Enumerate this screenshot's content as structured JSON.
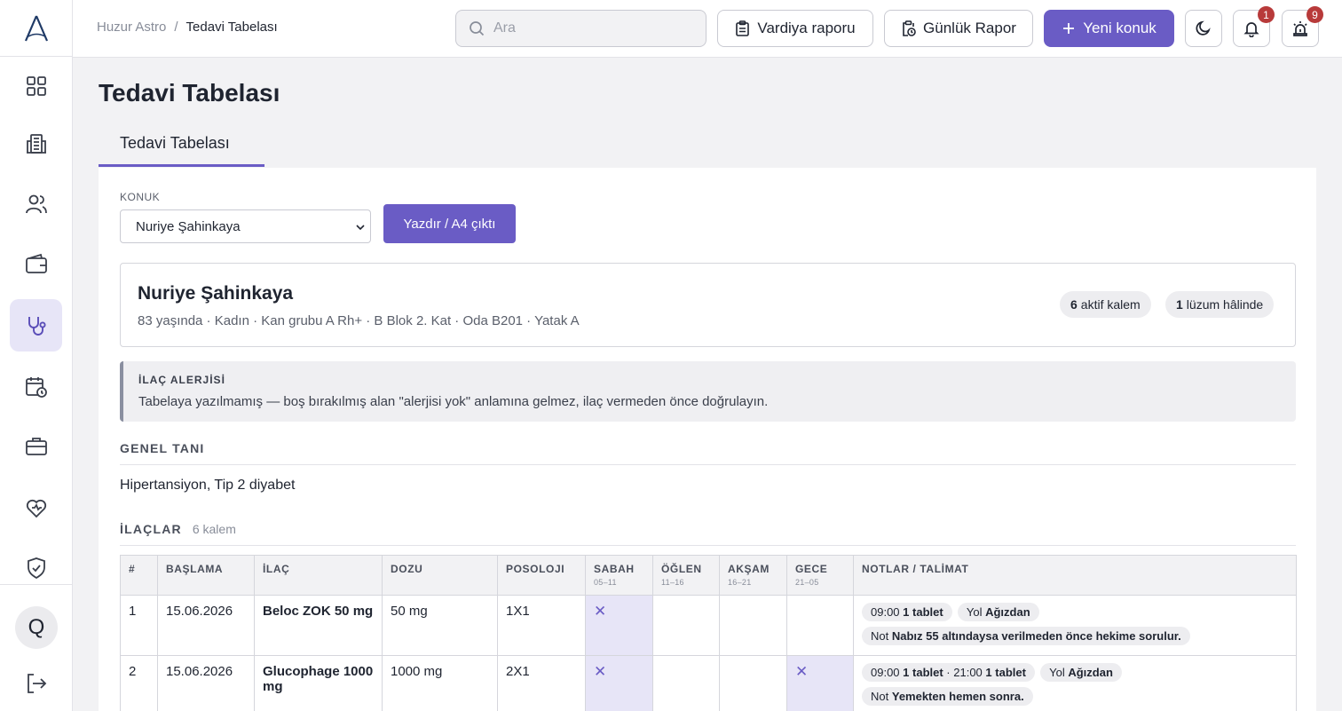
{
  "header": {
    "breadcrumb": [
      "Huzur Astro",
      "Tedavi Tabelası"
    ],
    "search_placeholder": "Ara",
    "buttons": {
      "shift_report": "Vardiya raporu",
      "daily_report": "Günlük Rapor",
      "new_guest": "Yeni konuk"
    },
    "notifications_count": "1",
    "alarms_count": "9"
  },
  "sidebar": {
    "avatar_initial": "Q",
    "items": [
      "dashboard-icon",
      "building-icon",
      "users-icon",
      "wallet-icon",
      "stethoscope-icon",
      "calendar-clock-icon",
      "briefcase-icon",
      "heart-icon",
      "shield-check-icon"
    ],
    "active_index": 4
  },
  "page": {
    "title": "Tedavi Tabelası",
    "tab": "Tedavi Tabelası"
  },
  "form": {
    "guest_label": "KONUK",
    "guest_value": "Nuriye Şahinkaya",
    "print_button": "Yazdır / A4 çıktı"
  },
  "patient": {
    "name": "Nuriye Şahinkaya",
    "meta": "83 yaşında · Kadın · Kan grubu A Rh+ · B Blok 2. Kat · Oda B201 · Yatak A",
    "active_count": "6",
    "active_label": "aktif kalem",
    "prn_count": "1",
    "prn_label": "lüzum hâlinde"
  },
  "allergy": {
    "title": "İLAÇ ALERJİSİ",
    "text": "Tabelaya yazılmamış — boş bırakılmış alan \"alerjisi yok\" anlamına gelmez, ilaç vermeden önce doğrulayın."
  },
  "diagnosis": {
    "title": "GENEL TANI",
    "text": "Hipertansiyon, Tip 2 diyabet"
  },
  "meds": {
    "title": "İLAÇLAR",
    "count_text": "6 kalem",
    "columns": {
      "num": "#",
      "start": "BAŞLAMA",
      "drug": "İLAÇ",
      "dose": "DOZU",
      "posology": "POSOLOJI",
      "morning": "SABAH",
      "morning_range": "05–11",
      "noon": "ÖĞLEN",
      "noon_range": "11–16",
      "evening": "AKŞAM",
      "evening_range": "16–21",
      "night": "GECE",
      "night_range": "21–05",
      "notes": "NOTLAR / TALİMAT"
    },
    "rows": [
      {
        "num": "1",
        "start": "15.06.2026",
        "drug": "Beloc ZOK 50 mg",
        "dose": "50 mg",
        "posology": "1X1",
        "slots": [
          true,
          false,
          false,
          false
        ],
        "time1": "09:00",
        "time1_amount": "1 tablet",
        "route_label": "Yol",
        "route": "Ağızdan",
        "note_label": "Not",
        "note": "Nabız 55 altındaysa verilmeden önce hekime sorulur."
      },
      {
        "num": "2",
        "start": "15.06.2026",
        "drug": "Glucophage 1000 mg",
        "dose": "1000 mg",
        "posology": "2X1",
        "slots": [
          true,
          false,
          false,
          true
        ],
        "time1": "09:00",
        "time1_amount": "1 tablet",
        "time2": "21:00",
        "time2_amount": "1 tablet",
        "route_label": "Yol",
        "route": "Ağızdan",
        "note_label": "Not",
        "note": "Yemekten hemen sonra."
      }
    ]
  }
}
